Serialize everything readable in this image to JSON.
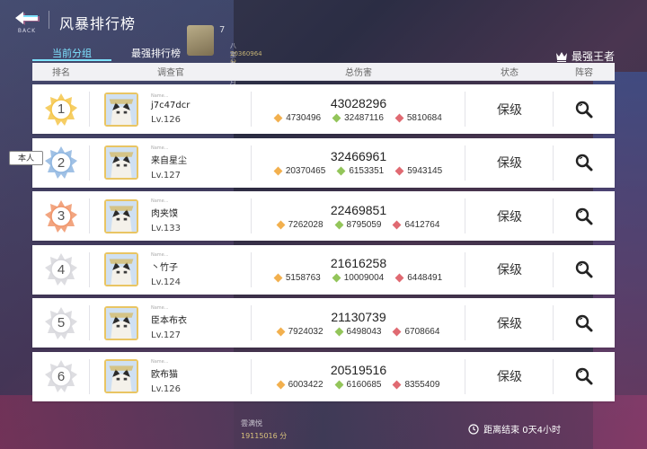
{
  "header": {
    "back_label": "BACK",
    "title": "风暴排行榜"
  },
  "top_player": {
    "rank": "7",
    "name": "八宝九银月",
    "score": "20360964 分"
  },
  "tabs": [
    {
      "label": "当前分组",
      "active": true
    },
    {
      "label": "最强排行榜",
      "active": false
    }
  ],
  "top_right": {
    "label": "最强王者"
  },
  "columns": {
    "rank": "排名",
    "investigator": "调查官",
    "total_damage": "总伤害",
    "status": "状态",
    "lineup": "阵容"
  },
  "self_tag": "本人",
  "rows": [
    {
      "rank": "1",
      "name_label": "Name...",
      "name": "j7c47dcr",
      "level": "Lv.126",
      "total": "43028296",
      "orange": "4730496",
      "green": "32487116",
      "red": "5810684",
      "status": "保级",
      "badge_color": "#f5c64a"
    },
    {
      "rank": "2",
      "name_label": "Name...",
      "name": "来自星尘",
      "level": "Lv.127",
      "total": "32466961",
      "orange": "20370465",
      "green": "6153351",
      "red": "5943145",
      "status": "保级",
      "badge_color": "#8fb6e0"
    },
    {
      "rank": "3",
      "name_label": "Name...",
      "name": "肉夹馍",
      "level": "Lv.133",
      "total": "22469851",
      "orange": "7262028",
      "green": "8795059",
      "red": "6412764",
      "status": "保级",
      "badge_color": "#f0956a"
    },
    {
      "rank": "4",
      "name_label": "Name...",
      "name": "丶竹子",
      "level": "Lv.124",
      "total": "21616258",
      "orange": "5158763",
      "green": "10009004",
      "red": "6448491",
      "status": "保级",
      "badge_color": "#d7d7dc"
    },
    {
      "rank": "5",
      "name_label": "Name...",
      "name": "臣本布衣",
      "level": "Lv.127",
      "total": "21130739",
      "orange": "7924032",
      "green": "6498043",
      "red": "6708664",
      "status": "保级",
      "badge_color": "#d7d7dc"
    },
    {
      "rank": "6",
      "name_label": "Name...",
      "name": "欧布猫",
      "level": "Lv.126",
      "total": "20519516",
      "orange": "6003422",
      "green": "6160685",
      "red": "8355409",
      "status": "保级",
      "badge_color": "#d7d7dc"
    }
  ],
  "bottom_player": {
    "name": "雲满悦",
    "score": "19115016 分"
  },
  "countdown": "距离结束 0天4小时",
  "colors": {
    "accent_tab": "#7ee3ff",
    "orange": "#f2b04e",
    "green": "#93c55a",
    "red": "#e06a72"
  },
  "icons": {
    "back": "back-arrow-icon",
    "king": "crown-wings-icon",
    "search": "magnifier-icon",
    "clock": "clock-icon"
  }
}
